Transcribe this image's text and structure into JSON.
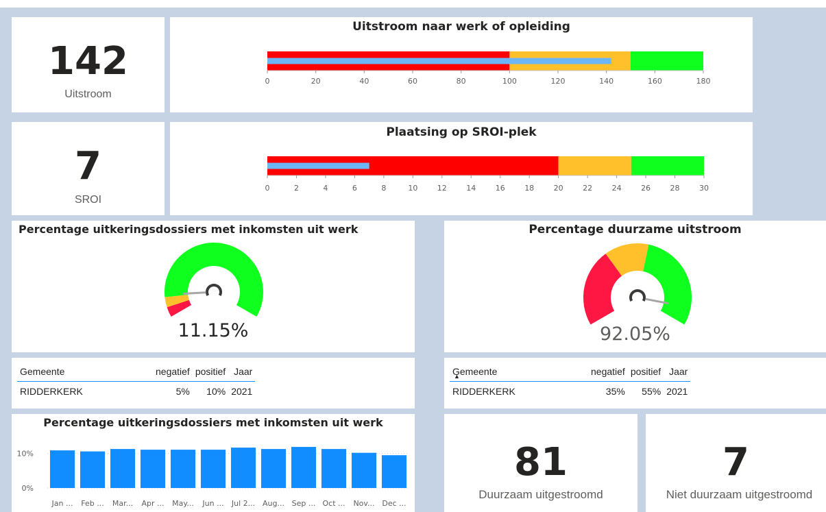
{
  "kpi_uitstroom": {
    "value": "142",
    "label": "Uitstroom"
  },
  "kpi_sroi": {
    "value": "7",
    "label": "SROI"
  },
  "bullet_uitstroom": {
    "title": "Uitstroom naar werk of opleiding",
    "max": 180,
    "bands": [
      {
        "to": 100,
        "color": "#ff0000"
      },
      {
        "to": 150,
        "color": "#ffc02b"
      },
      {
        "to": 180,
        "color": "#0fff1f"
      }
    ],
    "value": 142,
    "value_color": "#6cb6f5",
    "ticks": [
      "0",
      "20",
      "40",
      "60",
      "80",
      "100",
      "120",
      "140",
      "160",
      "180"
    ]
  },
  "bullet_sroi": {
    "title": "Plaatsing op SROI-plek",
    "max": 30,
    "bands": [
      {
        "to": 20,
        "color": "#ff0000"
      },
      {
        "to": 25,
        "color": "#ffc02b"
      },
      {
        "to": 30,
        "color": "#0fff1f"
      }
    ],
    "value": 7,
    "value_color": "#6cb6f5",
    "ticks": [
      "0",
      "2",
      "4",
      "6",
      "8",
      "10",
      "12",
      "14",
      "16",
      "18",
      "20",
      "22",
      "24",
      "26",
      "28",
      "30"
    ]
  },
  "gauge_inkomsten": {
    "title": "Percentage uitkeringsdossiers met inkomsten uit werk",
    "value_label": "11.15%",
    "value": 11.15,
    "max": 100,
    "bands": [
      {
        "to": 5,
        "color": "#ff1744"
      },
      {
        "to": 10,
        "color": "#ffc02b"
      },
      {
        "to": 100,
        "color": "#0fff1f"
      }
    ]
  },
  "gauge_duurzaam": {
    "title": "Percentage duurzame uitstroom",
    "value_label": "92.05%",
    "value": 92.05,
    "max": 100,
    "bands": [
      {
        "to": 35,
        "color": "#ff1744"
      },
      {
        "to": 55,
        "color": "#ffc02b"
      },
      {
        "to": 100,
        "color": "#0fff1f"
      }
    ]
  },
  "table_left": {
    "headers": [
      "Gemeente",
      "negatief",
      "positief",
      "Jaar"
    ],
    "rows": [
      [
        "RIDDERKERK",
        "5%",
        "10%",
        "2021"
      ]
    ]
  },
  "table_right": {
    "headers": [
      "Gemeente",
      "negatief",
      "positief",
      "Jaar"
    ],
    "rows": [
      [
        "RIDDERKERK",
        "35%",
        "55%",
        "2021"
      ]
    ]
  },
  "chart_data": {
    "type": "bar",
    "title": "Percentage uitkeringsdossiers met inkomsten uit werk",
    "categories": [
      "Jan ...",
      "Feb ...",
      "Mar...",
      "Apr ...",
      "May...",
      "Jun ...",
      "Jul 2...",
      "Aug...",
      "Sep ...",
      "Oct ...",
      "Nov...",
      "Dec ..."
    ],
    "values": [
      10.9,
      10.6,
      11.3,
      11.1,
      11.1,
      11.1,
      11.7,
      11.3,
      11.9,
      11.3,
      10.2,
      9.5
    ],
    "yticks": [
      "10%",
      "0%"
    ],
    "ylim": [
      0,
      13.5
    ],
    "grid": true,
    "color": "#118dff"
  },
  "kpi_duurzaam": {
    "value": "81",
    "label": "Duurzaam uitgestroomd"
  },
  "kpi_niet_duurzaam": {
    "value": "7",
    "label": "Niet duurzaam uitgestroomd"
  }
}
